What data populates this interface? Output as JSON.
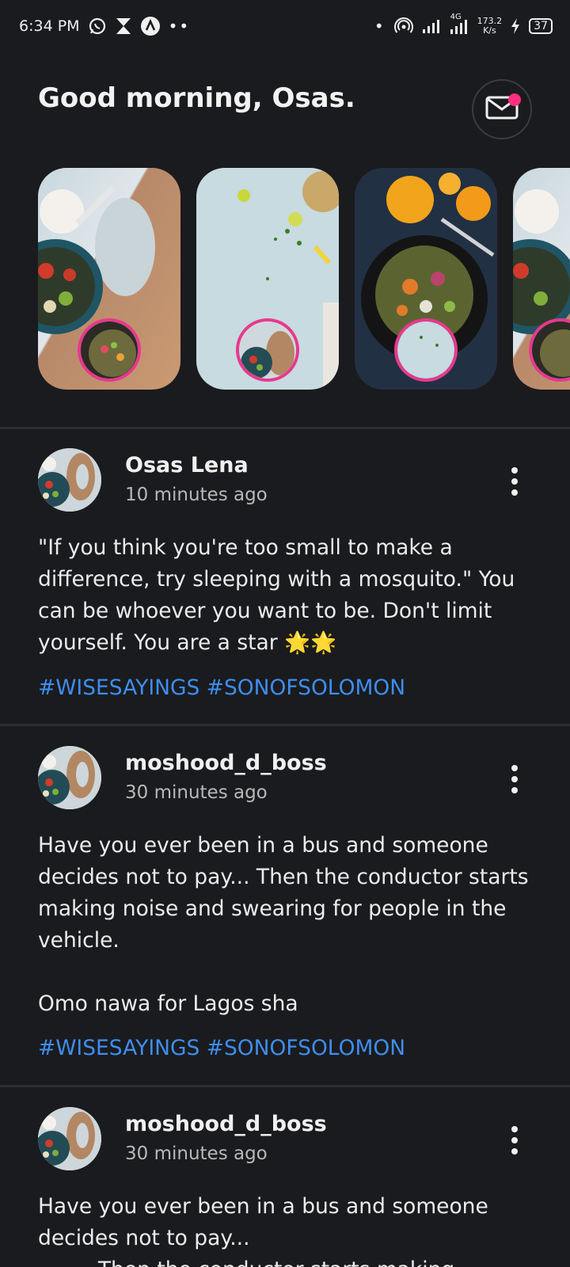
{
  "status_bar": {
    "time": "6:34 PM",
    "more_dots": "••",
    "dot": "•",
    "network": "4G",
    "speed_value": "173.2",
    "speed_unit": "K/s",
    "battery": "37"
  },
  "header": {
    "greeting": "Good morning, Osas.",
    "notification_color": "#ff2f7f"
  },
  "stories": [
    {
      "image": "salad-board"
    },
    {
      "image": "herbs-table"
    },
    {
      "image": "salad-orange"
    },
    {
      "image": "salad-board"
    }
  ],
  "posts": [
    {
      "author": "Osas Lena",
      "time": "10 minutes ago",
      "body": "\"If you think you're too small to make a difference, try sleeping with a mosquito.\" You can be whoever you want to be. Don't limit yourself. You are a star ",
      "emoji": "🌟🌟",
      "tags": "#WISESAYINGS #SONOFSOLOMON"
    },
    {
      "author": "moshood_d_boss",
      "time": "30 minutes ago",
      "body": "Have you ever been in a bus and someone decides not to pay... Then the conductor starts making noise and swearing for people in the vehicle.\n\nOmo nawa for Lagos sha",
      "tags": "#WISESAYINGS #SONOFSOLOMON"
    },
    {
      "author": "moshood_d_boss",
      "time": "30 minutes ago",
      "body": "Have you ever been in a bus and someone decides not to pay...\n         Then the conductor starts making"
    }
  ],
  "colors": {
    "background": "#1a1b1e",
    "accent_ring": "#e8388f",
    "hashtag": "#3e8ef0"
  }
}
